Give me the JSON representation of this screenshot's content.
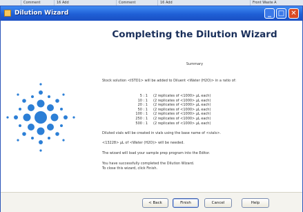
{
  "taskbar": {
    "items": [
      "Comment",
      "16 Add",
      "Comment",
      "16 Add",
      "Front Waste A"
    ]
  },
  "window": {
    "title": "Dilution Wizard",
    "minimize": "_",
    "maximize": "□",
    "close": "✕"
  },
  "content": {
    "heading": "Completing the Dilution Wizard",
    "summary_label": "Summary",
    "stock_line": "Stock solution <ISTD1> will be added to Diluent <Water (H2O)> in a ratio of:",
    "ratios": [
      {
        "ratio": "5 : 1",
        "detail": "(2 replicates of <1000> µL each)"
      },
      {
        "ratio": "10 : 1",
        "detail": "(2 replicates of <1000> µL each)"
      },
      {
        "ratio": "20 : 1",
        "detail": "(2 replicates of <1000> µL each)"
      },
      {
        "ratio": "50 : 1",
        "detail": "(2 replicates of <1000> µL each)"
      },
      {
        "ratio": "100 : 1",
        "detail": "(2 replicates of <1000> µL each)"
      },
      {
        "ratio": "250 : 1",
        "detail": "(2 replicates of <1000> µL each)"
      },
      {
        "ratio": "500 : 1",
        "detail": "(2 replicates of <1000> µL each)"
      }
    ],
    "vials_line": "Diluted vials will be created in vials using the base name of <vials>.",
    "needed_line": "<13228> µL of <Water (H2O)> will be needed.",
    "load_line": "The wizard will load your sample prep program into the Editor.",
    "success_line": "You have successfully completed the Dilution Wizard.",
    "close_line": "To close this wizard, click Finish."
  },
  "buttons": {
    "back": "< Back",
    "finish": "Finish",
    "cancel": "Cancel",
    "help": "Help"
  },
  "colors": {
    "title_bar": "#1f5fd6",
    "heading": "#1a2f5a",
    "logo_blue": "#2c7fd6"
  },
  "icons": {
    "logo": "spark-logo-icon",
    "app": "wizard-app-icon"
  }
}
